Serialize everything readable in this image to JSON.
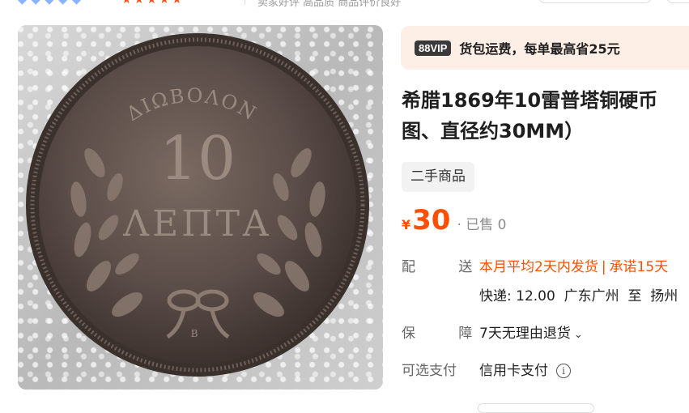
{
  "top": {
    "diamonds": "◆◆◆◆◆",
    "stars": "★★★★★",
    "meta": "卖家好评 高品质 商品评价良好"
  },
  "product_image": {
    "coin_top_text": "ΔΙΩΒΟΛΟΝ",
    "coin_value": "10",
    "coin_unit": "ΛΕΠΤΑ",
    "mint_mark": "B"
  },
  "vip": {
    "badge": "88VIP",
    "text": "货包运费，每单最高省25元"
  },
  "title": {
    "line1": "希腊1869年10雷普塔铜硬币",
    "line2": "图、直径约30MM）"
  },
  "tag": "二手商品",
  "price": {
    "currency": "¥",
    "value": "30",
    "sold": "· 已售 0"
  },
  "delivery": {
    "label": "配 送",
    "promise": "本月平均2天内发货",
    "promise2": "承诺15天",
    "express": "快递: 12.00",
    "from": "广东广州",
    "to_word": "至",
    "dest": "扬州"
  },
  "guarantee": {
    "label": "保 障",
    "value": "7天无理由退货"
  },
  "payment": {
    "label": "可选支付",
    "value": "信用卡支付"
  },
  "colors": {
    "accent": "#ff5000",
    "vip_bg": "#fdeee6"
  },
  "icons": {
    "info": "info-icon",
    "chevron": "chevron-down-icon"
  }
}
